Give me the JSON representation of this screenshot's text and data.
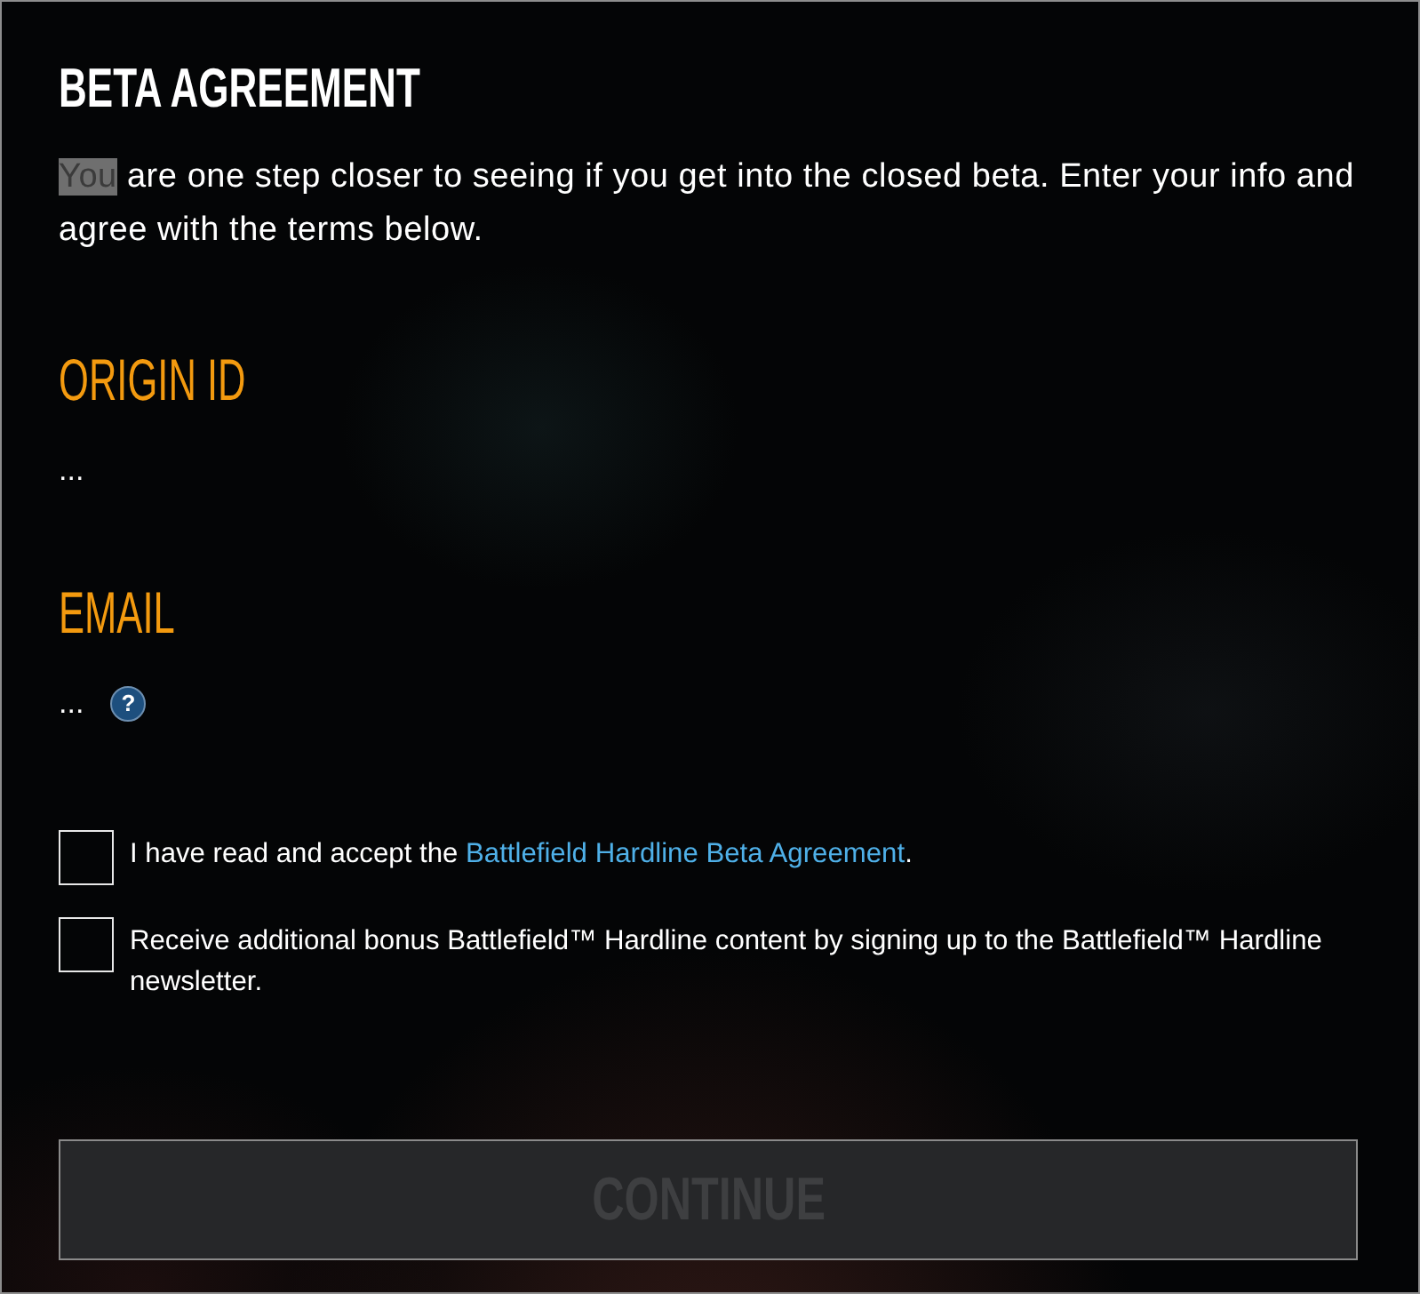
{
  "title": "BETA AGREEMENT",
  "intro": [
    {
      "text": "You",
      "selected": true
    },
    {
      "text": " are one step closer to seeing if you get into the closed beta. Enter your info and agree with the terms below.",
      "selected": false
    }
  ],
  "fields": [
    {
      "label": "ORIGIN ID",
      "value": "..."
    },
    {
      "label": "EMAIL",
      "value": "...",
      "help": "?"
    }
  ],
  "checkboxes": [
    {
      "checked": false,
      "label": [
        {
          "kind": "text",
          "text": "I have read and accept the "
        },
        {
          "kind": "link",
          "text": "Battlefield Hardline Beta Agreement"
        },
        {
          "kind": "text",
          "text": "."
        }
      ]
    },
    {
      "checked": false,
      "label": [
        {
          "kind": "text",
          "text": "Receive additional bonus Battlefield™ Hardline content by signing up to the Battlefield™ Hardline newsletter."
        }
      ]
    }
  ],
  "continue_button": {
    "label": "CONTINUE",
    "disabled": true
  }
}
